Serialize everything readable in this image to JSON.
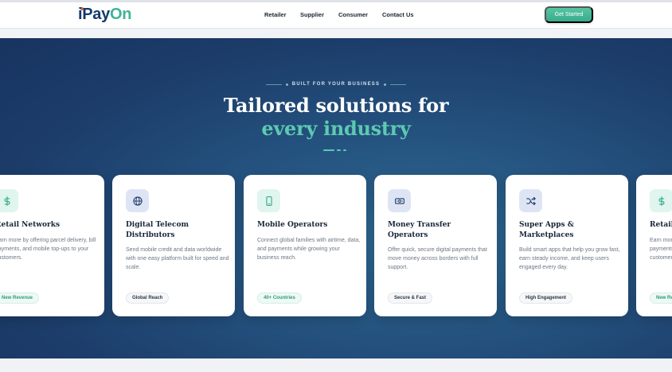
{
  "header": {
    "logo_part1": "iPay",
    "logo_part2": "On",
    "nav": [
      "Retailer",
      "Supplier",
      "Consumer",
      "Contact Us"
    ],
    "cta": "Get Started"
  },
  "hero": {
    "eyebrow": "BUILT FOR YOUR BUSINESS",
    "title_line1": "Tailored solutions for",
    "title_line2": "every industry"
  },
  "colors": {
    "brand_navy": "#123a6a",
    "brand_green": "#3fb596",
    "accent_teal": "#5ccab0",
    "hero_bg": "#1c3c69"
  },
  "cards": [
    {
      "icon": "dollar-icon",
      "title": "Retail Networks",
      "description": "Earn more by offering parcel delivery, bill payments, and mobile top-ups to your customers.",
      "badge": "New Revenue"
    },
    {
      "icon": "globe-icon",
      "title": "Digital Telecom Distributors",
      "description": "Send mobile credit and data worldwide with one easy platform built for speed and scale.",
      "badge": "Global Reach"
    },
    {
      "icon": "phone-icon",
      "title": "Mobile Operators",
      "description": "Connect global families with airtime, data, and payments while growing your business reach.",
      "badge": "40+ Countries"
    },
    {
      "icon": "banknote-icon",
      "title": "Money Transfer Operators",
      "description": "Offer quick, secure digital payments that move money across borders with full support.",
      "badge": "Secure & Fast"
    },
    {
      "icon": "shuffle-icon",
      "title": "Super Apps & Marketplaces",
      "description": "Build smart apps that help you grow fast, earn steady income, and keep users engaged every day.",
      "badge": "High Engagement"
    },
    {
      "icon": "dollar-icon",
      "title": "Retail Networks",
      "description": "Earn more by offering parcel delivery, bill payments, and mobile top-ups to your customers.",
      "badge": "New Revenue"
    }
  ]
}
